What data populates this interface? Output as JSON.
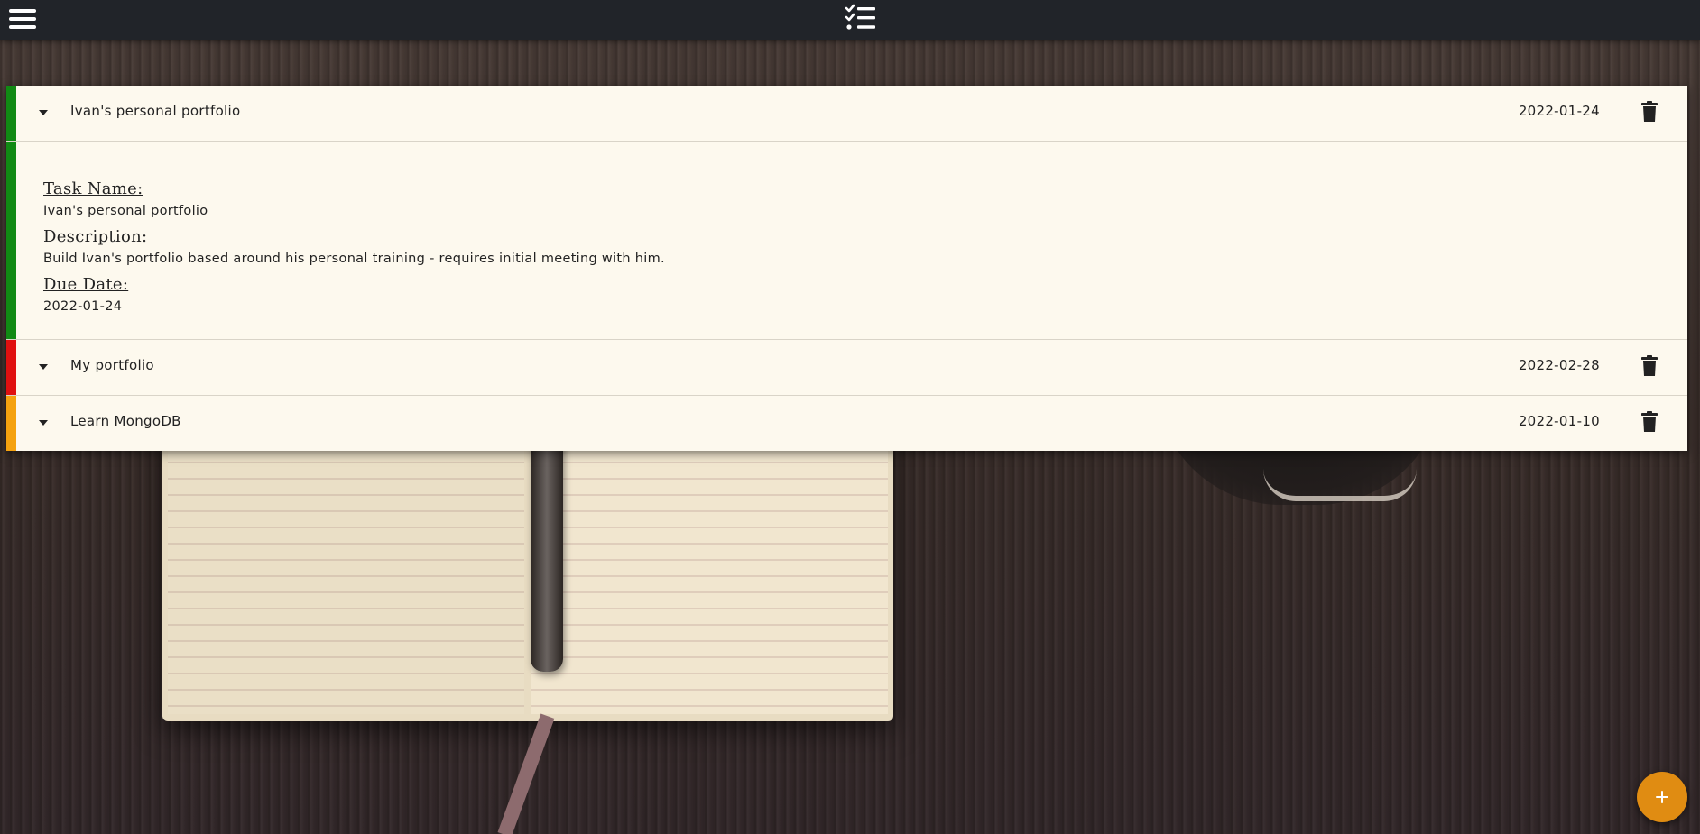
{
  "app": {
    "menu_icon": "hamburger-menu-icon",
    "logo_icon": "checklist-icon"
  },
  "tasks": [
    {
      "title": "Ivan's personal portfolio",
      "date": "2022-01-24",
      "priority_color": "#118a14",
      "expanded": true,
      "details": {
        "name_label": "Task Name:",
        "name_value": "Ivan's personal portfolio",
        "description_label": "Description:",
        "description_value": "Build Ivan's portfolio based around his personal training - requires initial meeting with him.",
        "due_label": "Due Date:",
        "due_value": "2022-01-24"
      }
    },
    {
      "title": "My portfolio",
      "date": "2022-02-28",
      "priority_color": "#e01010",
      "expanded": false
    },
    {
      "title": "Learn MongoDB",
      "date": "2022-01-10",
      "priority_color": "#f5a20f",
      "expanded": false
    }
  ],
  "fab": {
    "icon": "plus-icon",
    "color": "#e08c12"
  }
}
